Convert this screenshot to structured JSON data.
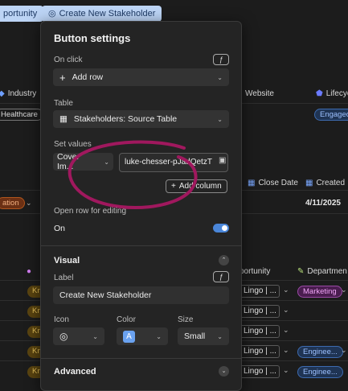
{
  "top_buttons": {
    "opportunity": "portunity",
    "create_stakeholder": "Create New Stakeholder"
  },
  "table": {
    "headers": {
      "industry": "Industry",
      "website": "Website",
      "lifecycle": "Lifecyc",
      "close_date": "Close Date",
      "created": "Created",
      "opportunity": "portunity",
      "department": "Departmen"
    },
    "industry_value": "Healthcare",
    "lifecycle_value": "Engaged",
    "stage_value": "ation",
    "created_value": "4/11/2025",
    "kn_badge": "Kn",
    "opportunity_cell": "Lingo | ...",
    "departments": [
      "Marketing",
      "",
      "",
      "Enginee...",
      "Enginee..."
    ]
  },
  "panel": {
    "title": "Button settings",
    "on_click_label": "On click",
    "action_value": "Add row",
    "table_label": "Table",
    "table_value": "Stakeholders: Source Table",
    "set_values_label": "Set values",
    "field_value": "Cover Im...",
    "field_input": "luke-chesser-pJadQetzT",
    "add_column_label": "Add column",
    "open_row_label": "Open row for editing",
    "open_row_value": "On",
    "visual_label": "Visual",
    "label_label": "Label",
    "label_value": "Create New Stakeholder",
    "icon_label": "Icon",
    "color_label": "Color",
    "color_value": "A",
    "size_label": "Size",
    "size_value": "Small",
    "advanced_label": "Advanced"
  },
  "colors": {
    "accent": "#4a86d9",
    "annotation": "#a0185e",
    "top_button": "#bcd4f5"
  }
}
